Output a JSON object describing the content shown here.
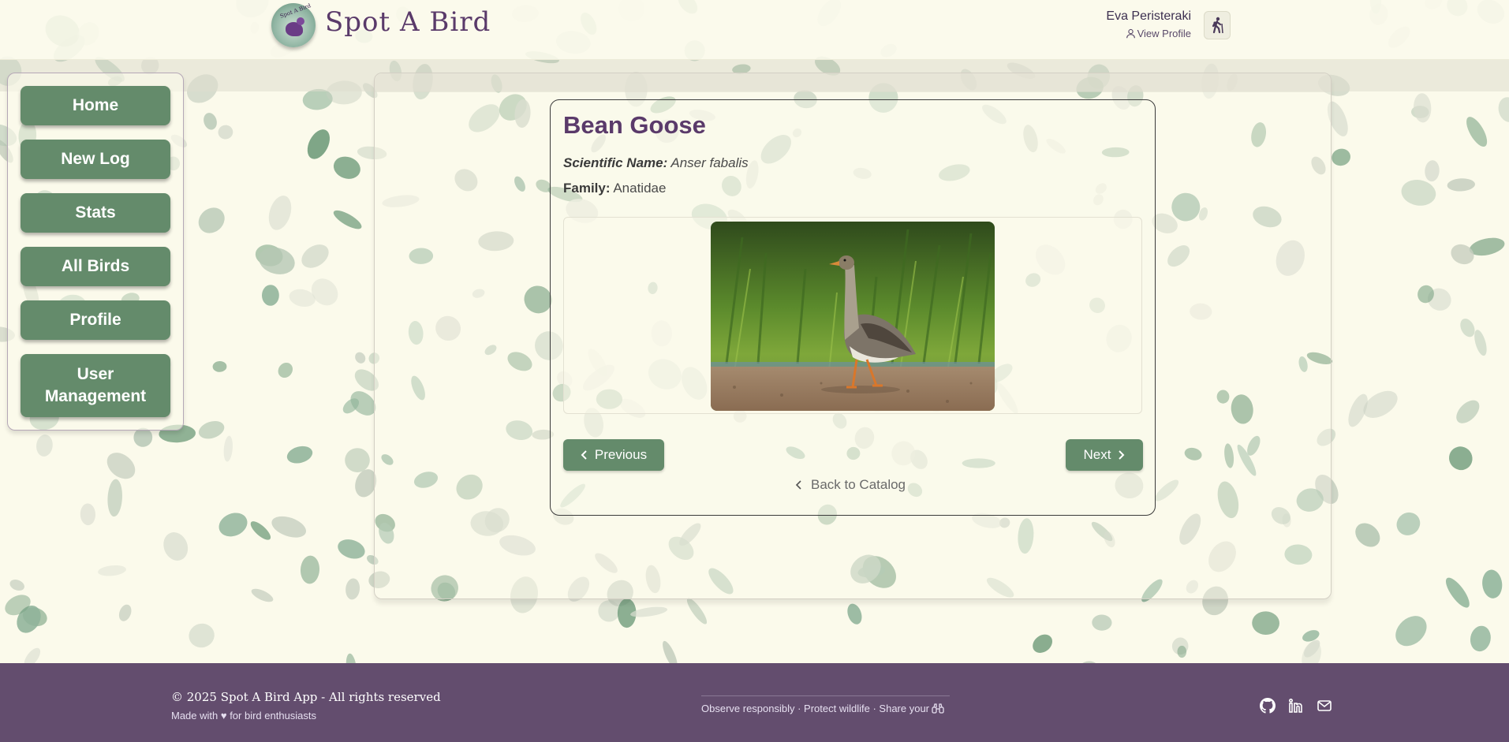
{
  "header": {
    "app_title": "Spot A Bird",
    "logo_text": "Spot A Bird",
    "user_name": "Eva Peristeraki",
    "view_profile": "View Profile"
  },
  "sidebar": {
    "items": [
      {
        "label": "Home"
      },
      {
        "label": "New Log"
      },
      {
        "label": "Stats"
      },
      {
        "label": "All Birds"
      },
      {
        "label": "Profile"
      },
      {
        "label": "User Management"
      }
    ]
  },
  "bird": {
    "name": "Bean Goose",
    "scientific_label": "Scientific Name:",
    "scientific_name": "Anser fabalis",
    "family_label": "Family:",
    "family": "Anatidae"
  },
  "navigation": {
    "previous": "Previous",
    "next": "Next",
    "back": "Back to Catalog"
  },
  "footer": {
    "copyright": "© 2025 Spot A Bird App - All rights reserved",
    "made_with": "Made with ♥ for bird enthusiasts",
    "tagline": "Observe responsibly · Protect wildlife · Share your"
  },
  "colors": {
    "background": "#fbfaeb",
    "accent_green": "#648b6b",
    "brand_purple": "#5a3a6a",
    "footer": "#634d6e"
  }
}
